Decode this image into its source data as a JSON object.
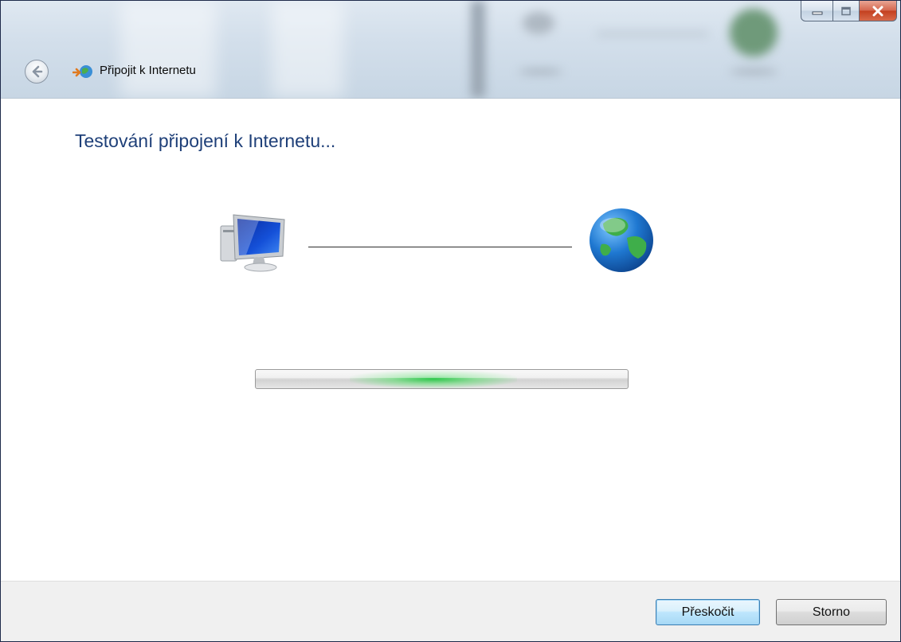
{
  "window": {
    "title": "Připojit k Internetu",
    "caption_buttons": {
      "minimize_icon": "minimize-icon",
      "maximize_icon": "maximize-icon",
      "close_icon": "close-icon"
    }
  },
  "content": {
    "heading": "Testování připojení k Internetu...",
    "left_icon": "computer-icon",
    "right_icon": "globe-icon",
    "progress": {
      "mode": "marquee",
      "color": "#2ecc40"
    }
  },
  "footer": {
    "skip_label": "Přeskočit",
    "cancel_label": "Storno"
  },
  "colors": {
    "heading": "#1e3f78",
    "close_button": "#c3401f",
    "default_button_border": "#3c7fb1"
  }
}
